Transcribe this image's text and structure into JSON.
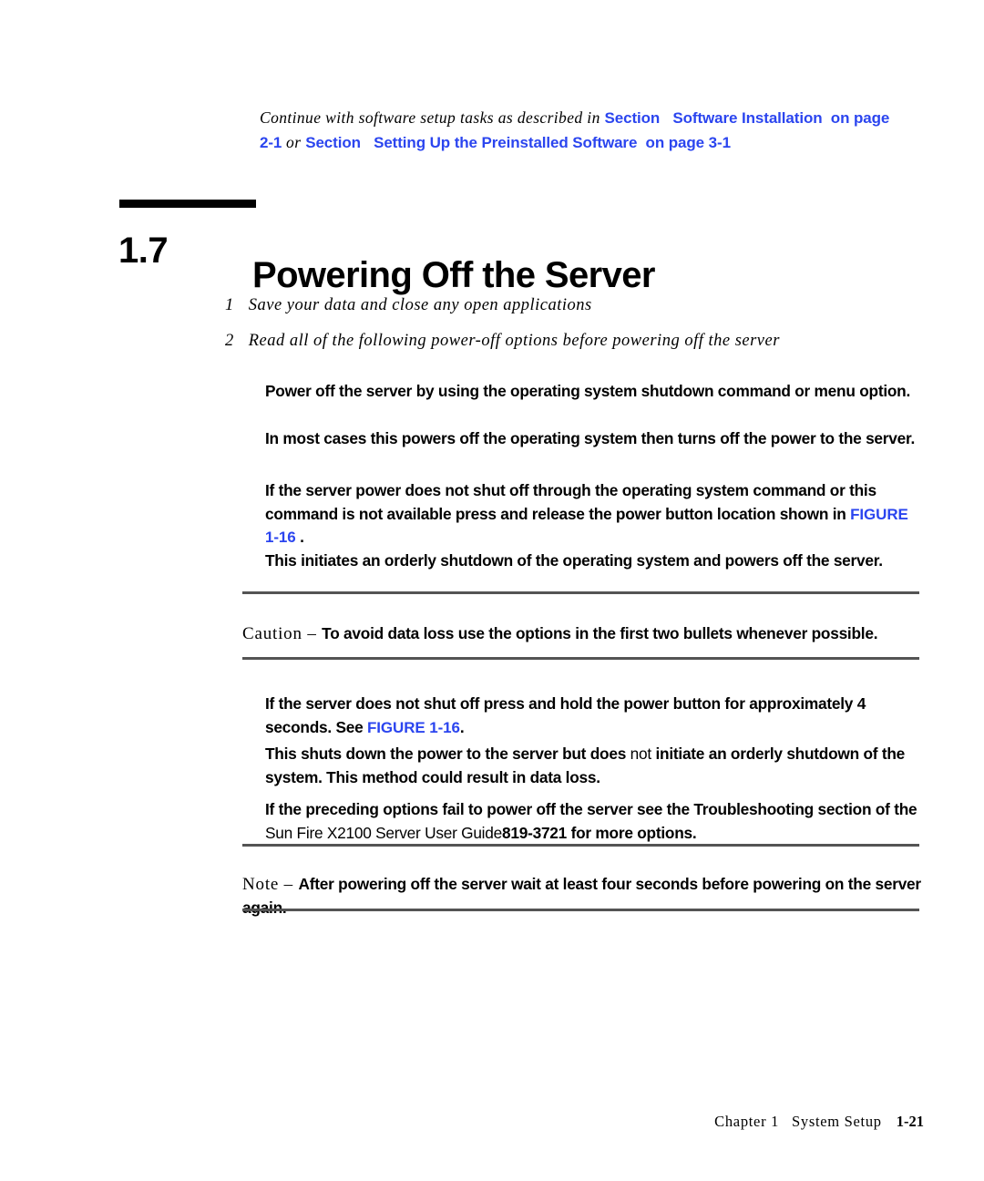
{
  "intro": {
    "lead": "Continue with software setup tasks as described in ",
    "xref1": "Section",
    "xref1b": "Software Installation",
    "xref1c": " on page 2-1",
    "conjunction": " or ",
    "xref2": "Section",
    "xref2b": "Setting Up the Preinstalled Software",
    "xref2c": " on page 3-1"
  },
  "heading": {
    "number": "1.7",
    "title": "Powering Off the Server"
  },
  "steps": [
    {
      "number": "1",
      "text": "Save your data and close any open applications"
    },
    {
      "number": "2",
      "text": "Read all of the following power-off options before powering off the server"
    }
  ],
  "paragraphs": {
    "p1": "Power off the server by using the operating system shutdown command or menu option.",
    "p2": "In most cases  this powers off the operating system then turns off the power to the server.",
    "p3_a": "If the server power does not shut off through the operating system command or this command is not available  press and release the power button  location shown in ",
    "p3_xref": "FIGURE 1-16",
    "p3_b": " .",
    "p4": "This initiates an orderly shutdown of the operating system and powers off the server.",
    "p5_a": "If the server does not shut off  press and hold the power button for approximately 4 seconds. See ",
    "p5_xref": "FIGURE 1-16",
    "p5_b": ".",
    "p6_a": "This shuts down the power to the server but does ",
    "p6_em": "not",
    "p6_b": " initiate an orderly shutdown of the system. This method could result in data loss.",
    "p7_a": "If the preceding options fail to power off the server  see the Troubleshooting section of the ",
    "p7_title": "Sun Fire X2100 Server User Guide",
    "p7_num": "819-3721",
    "p7_b": "  for more options."
  },
  "caution": {
    "keyword": "Caution – ",
    "text": "To avoid data loss  use the options in the first two bullets whenever possible."
  },
  "note": {
    "keyword": "Note – ",
    "text": "After powering off the server  wait at least four seconds before powering on the server again."
  },
  "footer": {
    "chapter": "Chapter 1",
    "section": "System Setup",
    "page": "1-21"
  },
  "colors": {
    "xref_blue": "#2b45ef",
    "rule_gray": "#545454",
    "text_black": "#000000"
  }
}
